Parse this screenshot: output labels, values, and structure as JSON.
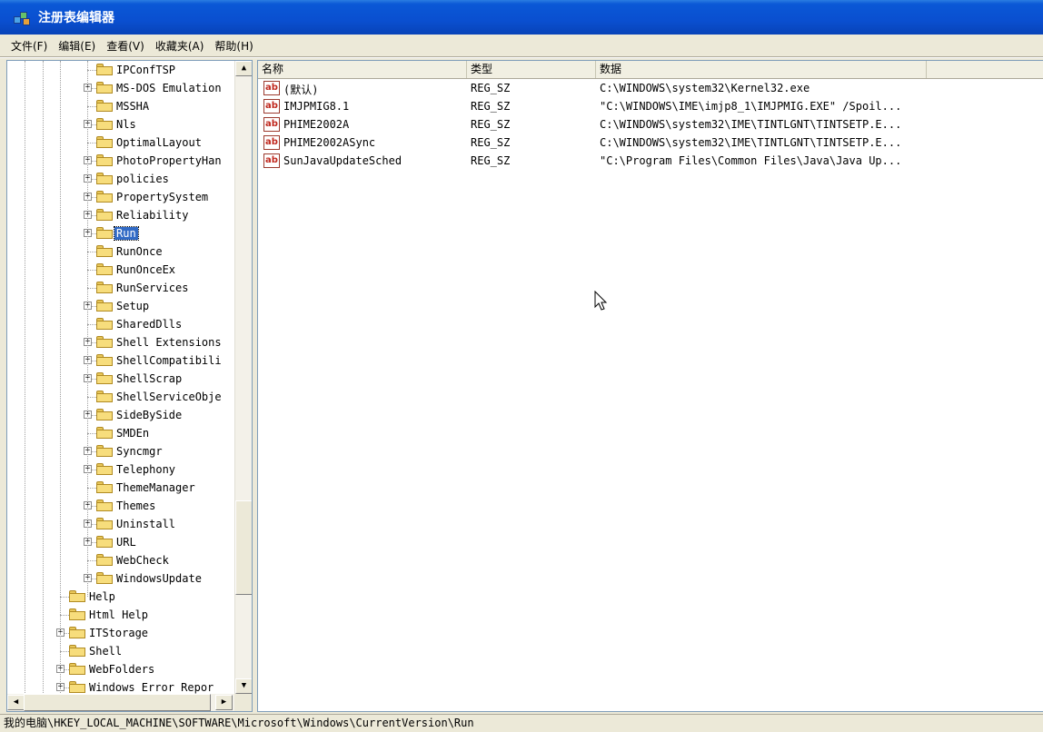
{
  "window": {
    "title": "注册表编辑器"
  },
  "menu": [
    {
      "label": "文件(F)"
    },
    {
      "label": "编辑(E)"
    },
    {
      "label": "查看(V)"
    },
    {
      "label": "收藏夹(A)"
    },
    {
      "label": "帮助(H)"
    }
  ],
  "tree": [
    {
      "label": "IPConfTSP",
      "expander": false,
      "level": 2
    },
    {
      "label": "MS-DOS Emulation",
      "expander": true,
      "level": 2
    },
    {
      "label": "MSSHA",
      "expander": false,
      "level": 2
    },
    {
      "label": "Nls",
      "expander": true,
      "level": 2
    },
    {
      "label": "OptimalLayout",
      "expander": false,
      "level": 2
    },
    {
      "label": "PhotoPropertyHan",
      "expander": true,
      "level": 2
    },
    {
      "label": "policies",
      "expander": true,
      "level": 2
    },
    {
      "label": "PropertySystem",
      "expander": true,
      "level": 2
    },
    {
      "label": "Reliability",
      "expander": true,
      "level": 2
    },
    {
      "label": "Run",
      "expander": true,
      "level": 2,
      "selected": true
    },
    {
      "label": "RunOnce",
      "expander": false,
      "level": 2
    },
    {
      "label": "RunOnceEx",
      "expander": false,
      "level": 2
    },
    {
      "label": "RunServices",
      "expander": false,
      "level": 2
    },
    {
      "label": "Setup",
      "expander": true,
      "level": 2
    },
    {
      "label": "SharedDlls",
      "expander": false,
      "level": 2
    },
    {
      "label": "Shell Extensions",
      "expander": true,
      "level": 2
    },
    {
      "label": "ShellCompatibili",
      "expander": true,
      "level": 2
    },
    {
      "label": "ShellScrap",
      "expander": true,
      "level": 2
    },
    {
      "label": "ShellServiceObje",
      "expander": false,
      "level": 2
    },
    {
      "label": "SideBySide",
      "expander": true,
      "level": 2
    },
    {
      "label": "SMDEn",
      "expander": false,
      "level": 2
    },
    {
      "label": "Syncmgr",
      "expander": true,
      "level": 2
    },
    {
      "label": "Telephony",
      "expander": true,
      "level": 2
    },
    {
      "label": "ThemeManager",
      "expander": false,
      "level": 2
    },
    {
      "label": "Themes",
      "expander": true,
      "level": 2
    },
    {
      "label": "Uninstall",
      "expander": true,
      "level": 2
    },
    {
      "label": "URL",
      "expander": true,
      "level": 2
    },
    {
      "label": "WebCheck",
      "expander": false,
      "level": 2
    },
    {
      "label": "WindowsUpdate",
      "expander": true,
      "level": 2
    },
    {
      "label": "Help",
      "expander": false,
      "level": 1
    },
    {
      "label": "Html Help",
      "expander": false,
      "level": 1
    },
    {
      "label": "ITStorage",
      "expander": true,
      "level": 1
    },
    {
      "label": "Shell",
      "expander": false,
      "level": 1
    },
    {
      "label": "WebFolders",
      "expander": true,
      "level": 1
    },
    {
      "label": "Windows Error Repor",
      "expander": true,
      "level": 1
    }
  ],
  "columns": [
    "名称",
    "类型",
    "数据"
  ],
  "values": [
    {
      "name": "(默认)",
      "type": "REG_SZ",
      "data": "C:\\WINDOWS\\system32\\Kernel32.exe"
    },
    {
      "name": "IMJPMIG8.1",
      "type": "REG_SZ",
      "data": "\"C:\\WINDOWS\\IME\\imjp8_1\\IMJPMIG.EXE\" /Spoil..."
    },
    {
      "name": "PHIME2002A",
      "type": "REG_SZ",
      "data": "C:\\WINDOWS\\system32\\IME\\TINTLGNT\\TINTSETP.E..."
    },
    {
      "name": "PHIME2002ASync",
      "type": "REG_SZ",
      "data": "C:\\WINDOWS\\system32\\IME\\TINTLGNT\\TINTSETP.E..."
    },
    {
      "name": "SunJavaUpdateSched",
      "type": "REG_SZ",
      "data": "\"C:\\Program Files\\Common Files\\Java\\Java Up..."
    }
  ],
  "value_icon": "ab",
  "status": {
    "path": "我的电脑\\HKEY_LOCAL_MACHINE\\SOFTWARE\\Microsoft\\Windows\\CurrentVersion\\Run"
  },
  "scroll_glyphs": {
    "up": "▲",
    "down": "▼",
    "left": "◀",
    "right": "▶"
  }
}
